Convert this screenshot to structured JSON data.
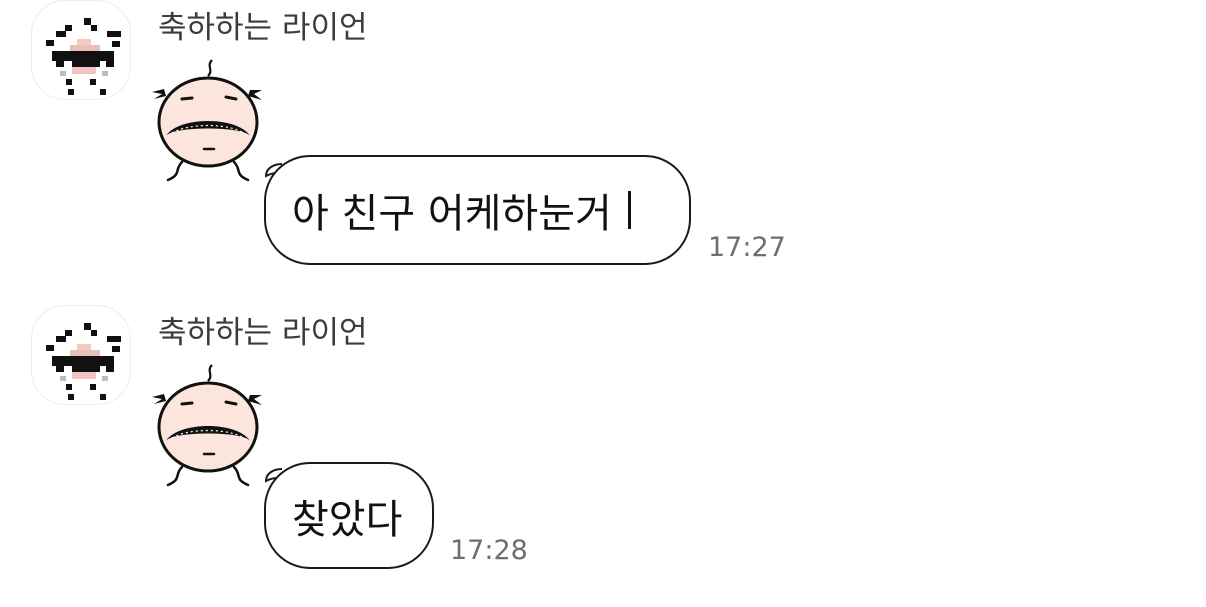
{
  "messages": [
    {
      "sender": "축하하는 라이언",
      "text": "아 친구 어케하눈거",
      "time": "17:27",
      "sticker": "frowning-character-sticker",
      "avatar": "pixel-lion-avatar"
    },
    {
      "sender": "축하하는 라이언",
      "text": "찾았다",
      "time": "17:28",
      "sticker": "frowning-character-sticker",
      "avatar": "pixel-lion-avatar"
    }
  ],
  "colors": {
    "background": "#ffffff",
    "bubble_border": "#1a1a1a",
    "sender_text": "#3c3c3c",
    "timestamp_text": "#6e6e6e"
  }
}
